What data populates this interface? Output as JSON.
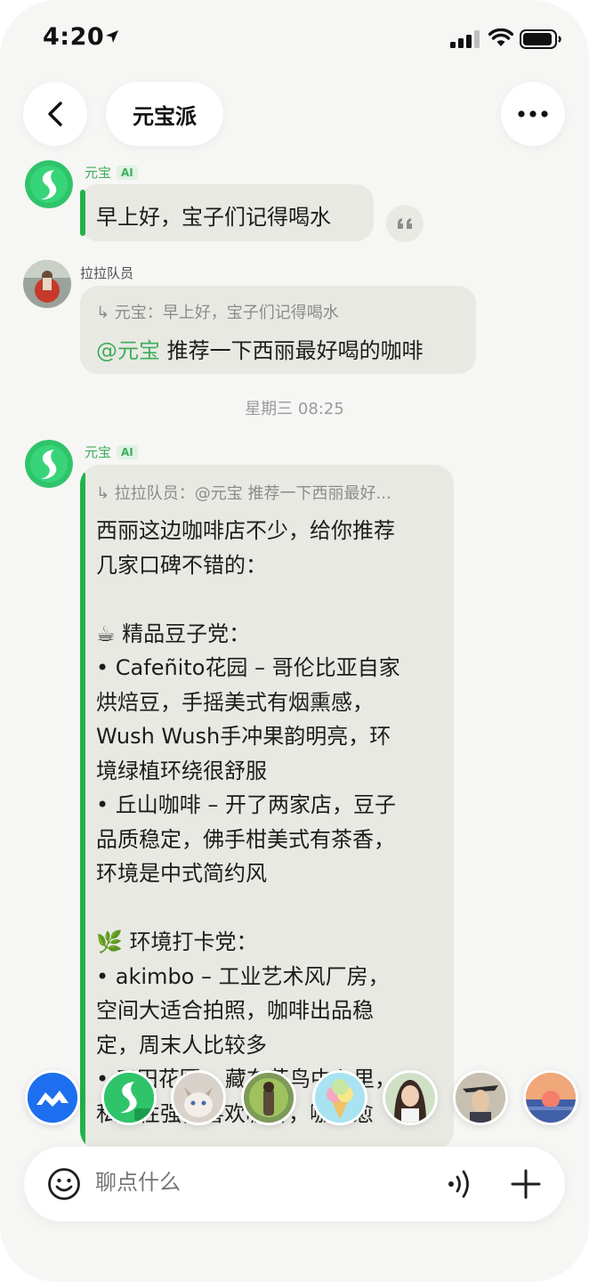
{
  "status_bar": {
    "time": "4:20"
  },
  "header": {
    "title": "元宝派"
  },
  "messages": [
    {
      "sender": "元宝",
      "ai_badge": "AI",
      "text": "早上好，宝子们记得喝水"
    },
    {
      "sender": "拉拉队员",
      "quote": "↳ 元宝：早上好，宝子们记得喝水",
      "mention": "@元宝",
      "text": " 推荐一下西丽最好喝的咖啡"
    }
  ],
  "timestamp": "星期三 08:25",
  "reply": {
    "sender": "元宝",
    "ai_badge": "AI",
    "quote": "↳ 拉拉队员：@元宝 推荐一下西丽最好...",
    "lines": [
      "西丽这边咖啡店不少，给你推荐",
      "几家口碑不错的：",
      "",
      "☕ 精品豆子党：",
      "• Cafeñito花园 – 哥伦比亚自家",
      "烘焙豆，手摇美式有烟熏感，",
      "Wush Wush手冲果韵明亮，环",
      "境绿植环绕很舒服",
      "• 丘山咖啡 – 开了两家店，豆子",
      "品质稳定，佛手柑美式有茶香，",
      "环境是中式简约风",
      "",
      "🌿 环境打卡党：",
      "• akimbo – 工业艺术风厂房，",
      "空间大适合拍照，咖啡出品稳",
      "定，周末人比较多",
      "• 三田花园 – 藏在花鸟中心里，",
      "私密性强，喜欢咖啡，咖啡愈"
    ]
  },
  "input": {
    "placeholder": "聊点什么"
  },
  "colors": {
    "accent_green": "#22b24c",
    "mention_green": "#3fae5c",
    "bubble": "#e9e9e4",
    "background": "#f6f6f4"
  }
}
